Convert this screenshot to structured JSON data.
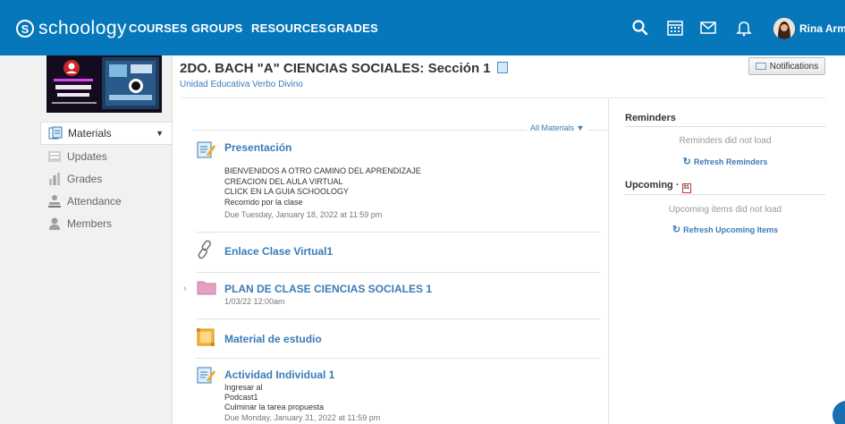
{
  "header": {
    "logo_text": "schoology",
    "logo_mark": "S",
    "nav": [
      "COURSES",
      "GROUPS",
      "RESOURCES",
      "GRADES"
    ],
    "user_name": "Rina Armij",
    "icons": [
      "search-icon",
      "calendar-icon",
      "mail-icon",
      "bell-icon"
    ]
  },
  "sidebar": {
    "items": [
      {
        "label": "Materials",
        "icon": "materials-icon",
        "active": true
      },
      {
        "label": "Updates",
        "icon": "updates-icon"
      },
      {
        "label": "Grades",
        "icon": "grades-icon"
      },
      {
        "label": "Attendance",
        "icon": "attendance-icon"
      },
      {
        "label": "Members",
        "icon": "members-icon"
      }
    ]
  },
  "course": {
    "title": "2DO. BACH \"A\" CIENCIAS SOCIALES: Sección 1",
    "school": "Unidad Educativa Verbo Divino",
    "notifications_label": "Notifications",
    "filter_label": "All Materials"
  },
  "materials": [
    {
      "title": "Presentación",
      "lines": [
        "BIENVENIDOS A OTRO CAMINO DEL APRENDIZAJE",
        "CREACION DEL AULA VIRTUAL",
        "CLICK EN LA GUIA SCHOOLOGY",
        "Recorrido por la clase"
      ],
      "due": "Due Tuesday, January 18, 2022 at 11:59 pm",
      "icon": "assignment-icon"
    },
    {
      "title": "Enlace Clase Virtual1",
      "icon": "link-icon"
    },
    {
      "title": "PLAN DE CLASE CIENCIAS SOCIALES 1",
      "date": "1/03/22 12:00am",
      "icon": "folder-icon"
    },
    {
      "title": "Material de estudio",
      "icon": "page-icon"
    },
    {
      "title": "Actividad Individual 1",
      "lines": [
        "Ingresar al",
        "Podcast1",
        "Culminar la tarea propuesta"
      ],
      "due": "Due Monday, January 31, 2022 at 11:59 pm",
      "icon": "assignment-icon"
    }
  ],
  "reminders": {
    "heading": "Reminders",
    "message": "Reminders did not load",
    "refresh_label": "Refresh Reminders"
  },
  "upcoming": {
    "heading": "Upcoming ·",
    "calendar_day": "31",
    "message": "Upcoming items did not load",
    "refresh_label": "Refresh Upcoming Items"
  },
  "colors": {
    "nav_bg": "#0677ba",
    "link": "#3b7bb8",
    "folder": "#e6a0c4"
  }
}
